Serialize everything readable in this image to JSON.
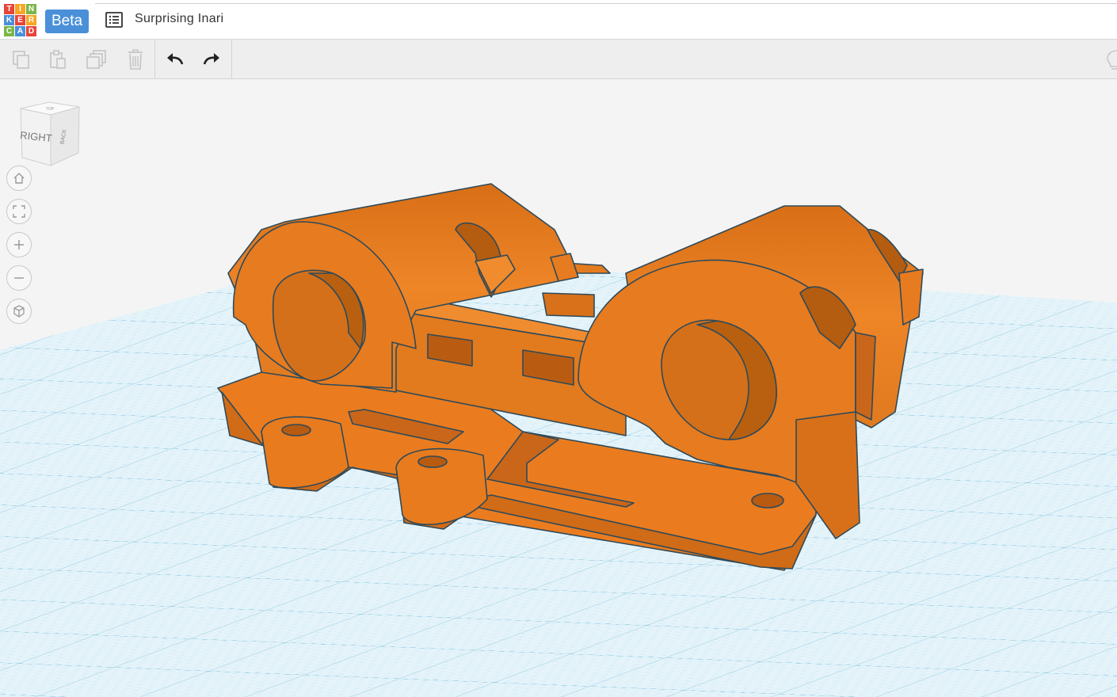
{
  "app": {
    "logo_letters": [
      "T",
      "I",
      "N",
      "K",
      "E",
      "R",
      "C",
      "A",
      "D"
    ],
    "logo_colors": [
      "#e8443a",
      "#f6a623",
      "#7ab648",
      "#4a90d9",
      "#e8443a",
      "#f6a623",
      "#7ab648",
      "#4a90d9",
      "#e8443a"
    ],
    "beta_label": "Beta",
    "design_title": "Surprising Inari"
  },
  "toolbar": {
    "buttons": [
      {
        "name": "copy-icon",
        "enabled": false
      },
      {
        "name": "paste-icon",
        "enabled": false
      },
      {
        "name": "duplicate-icon",
        "enabled": false
      },
      {
        "name": "delete-icon",
        "enabled": false
      },
      {
        "name": "undo-icon",
        "enabled": true
      },
      {
        "name": "redo-icon",
        "enabled": true
      }
    ]
  },
  "viewcube": {
    "front_label": "RIGHT",
    "side_label": "BACK",
    "top_label": "TOP"
  },
  "view_controls": [
    {
      "name": "home-view-icon"
    },
    {
      "name": "fit-all-icon"
    },
    {
      "name": "zoom-in-icon"
    },
    {
      "name": "zoom-out-icon"
    },
    {
      "name": "perspective-icon"
    }
  ],
  "colors": {
    "model": "#e87d1e",
    "grid": "#7fc4e0",
    "grid_background": "#e4f3fa",
    "accent": "#4a90d9"
  }
}
